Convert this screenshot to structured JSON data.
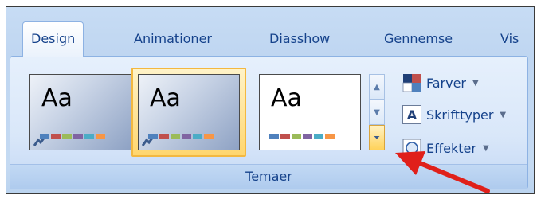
{
  "tabs": [
    "Design",
    "Animationer",
    "Diasshow",
    "Gennemse",
    "Vis"
  ],
  "active_tab": "Design",
  "themes": [
    {
      "preview_text": "Aa",
      "style": "dark"
    },
    {
      "preview_text": "Aa",
      "style": "dark-selected"
    },
    {
      "preview_text": "Aa",
      "style": "white"
    }
  ],
  "swatch_colors": [
    "#4f81bd",
    "#c0504d",
    "#9bbb59",
    "#8064a2",
    "#4bacc6",
    "#f79646"
  ],
  "commands": [
    {
      "label": "Farver",
      "icon": "color-palette-icon"
    },
    {
      "label": "Skrifttyper",
      "icon": "font-icon",
      "glyph": "A"
    },
    {
      "label": "Effekter",
      "icon": "effects-icon"
    }
  ],
  "group_label": "Temaer",
  "colors": {
    "accent_blue": "#15428b",
    "selection_orange": "#f3b840",
    "arrow_red": "#e0201a"
  }
}
